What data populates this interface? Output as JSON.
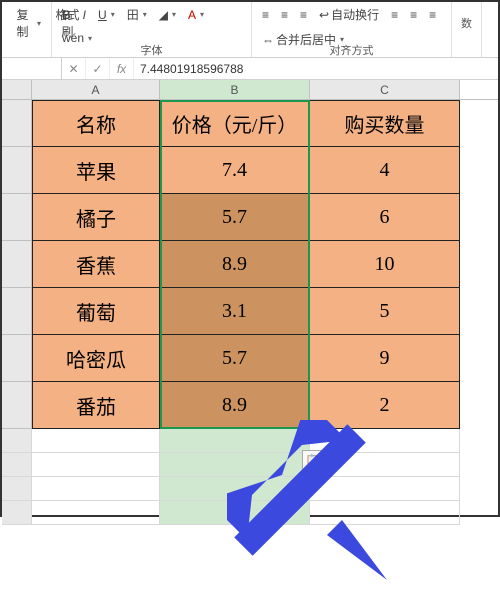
{
  "ribbon": {
    "copy_dd": "复制",
    "format_painter": "格式刷",
    "font_group_label": "字体",
    "align_group_label": "对齐方式",
    "bold": "B",
    "italic": "I",
    "underline": "U",
    "auto_wrap": "自动换行",
    "merge_center": "合并后居中",
    "number_label": "数"
  },
  "formula_bar": {
    "namebox": "",
    "fx_label": "fx",
    "value": "7.44801918596788"
  },
  "columns": {
    "A": "A",
    "B": "B",
    "C": "C"
  },
  "table": {
    "headers": {
      "name": "名称",
      "price": "价格（元/斤）",
      "qty": "购买数量"
    },
    "rows": [
      {
        "name": "苹果",
        "price": "7.4",
        "qty": "4"
      },
      {
        "name": "橘子",
        "price": "5.7",
        "qty": "6"
      },
      {
        "name": "香蕉",
        "price": "8.9",
        "qty": "10"
      },
      {
        "name": "葡萄",
        "price": "3.1",
        "qty": "5"
      },
      {
        "name": "哈密瓜",
        "price": "5.7",
        "qty": "9"
      },
      {
        "name": "番茄",
        "price": "8.9",
        "qty": "2"
      }
    ]
  },
  "chart_data": {
    "type": "table",
    "title": "",
    "columns": [
      "名称",
      "价格（元/斤）",
      "购买数量"
    ],
    "rows": [
      [
        "苹果",
        7.4,
        4
      ],
      [
        "橘子",
        5.7,
        6
      ],
      [
        "香蕉",
        8.9,
        10
      ],
      [
        "葡萄",
        3.1,
        5
      ],
      [
        "哈密瓜",
        5.7,
        9
      ],
      [
        "番茄",
        8.9,
        2
      ]
    ]
  }
}
